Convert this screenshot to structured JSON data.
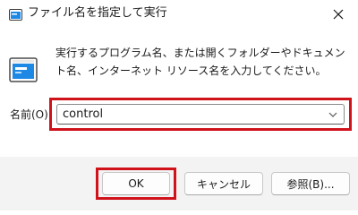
{
  "window": {
    "title": "ファイル名を指定して実行"
  },
  "dialog": {
    "description": "実行するプログラム名、または開くフォルダーやドキュメント名、インターネット リソース名を入力してください。",
    "open_label": "名前(O):",
    "open_value": "control"
  },
  "buttons": {
    "ok": "OK",
    "cancel": "キャンセル",
    "browse": "参照(B)..."
  },
  "colors": {
    "highlight": "#d0121b",
    "footer_background": "#f3f3f3",
    "icon_blue": "#1e88e5"
  },
  "icons": {
    "app": "run-app-icon",
    "close": "close-icon",
    "run": "run-program-icon",
    "dropdown": "chevron-down-icon"
  }
}
